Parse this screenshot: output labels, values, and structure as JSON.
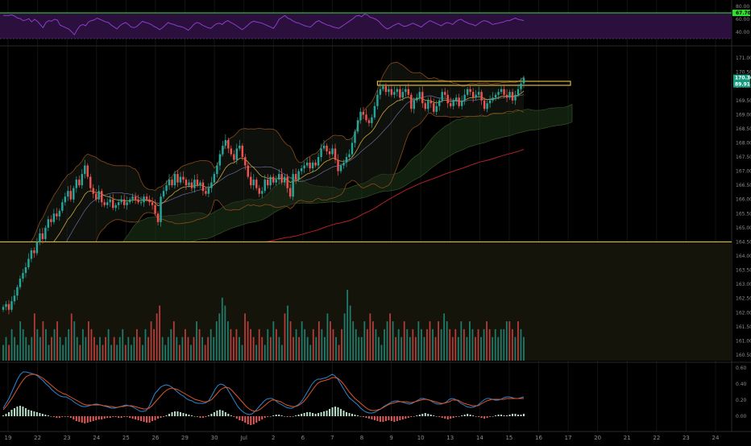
{
  "chart_data": [
    {
      "type": "line",
      "panel": "rsi",
      "yticks": [
        "80.00",
        "60.00",
        "40.00"
      ],
      "guide_levels": [
        70,
        30
      ],
      "ylim": [
        20,
        85
      ],
      "last_value_label": "67.70",
      "colors": {
        "line": "#8a3fc8",
        "band": "#2b0f3d",
        "upper": "#2fe02f",
        "lower": "#2fe02f"
      },
      "series": [
        {
          "values": [
            66,
            66,
            66,
            67,
            65,
            62,
            61,
            58,
            59,
            61,
            56,
            60,
            57,
            52,
            47,
            55,
            58,
            57,
            60,
            59,
            51,
            49,
            47,
            45,
            41,
            36,
            44,
            50,
            52,
            50,
            56,
            58,
            59,
            62,
            60,
            58,
            56,
            55,
            51,
            48,
            45,
            50,
            53,
            55,
            52,
            48,
            47,
            49,
            53,
            57,
            55,
            54,
            52,
            49,
            47,
            44,
            47,
            51,
            55,
            53,
            52,
            50,
            49,
            48,
            46,
            43,
            47,
            52,
            55,
            54,
            51,
            49,
            47,
            46,
            50,
            53,
            54,
            52,
            56,
            58,
            55,
            53,
            50,
            47,
            44,
            47,
            51,
            55,
            57,
            56,
            55,
            54,
            52,
            50,
            48,
            46,
            52,
            60,
            63,
            66,
            62,
            60,
            57,
            55,
            54,
            52,
            50,
            49,
            48,
            52,
            56,
            58,
            55,
            53,
            51,
            50,
            48,
            47,
            46,
            49,
            52,
            55,
            58,
            61,
            65,
            66,
            64,
            68,
            67,
            63,
            62,
            60,
            57,
            52,
            48,
            45,
            47,
            50,
            52,
            54,
            51,
            49,
            50,
            52,
            54,
            52,
            50,
            48,
            52,
            55,
            58,
            56,
            54,
            52,
            50,
            53,
            55,
            54,
            52,
            56,
            59,
            60,
            57,
            55,
            53,
            52,
            50,
            53,
            56,
            58,
            57,
            55,
            52,
            53,
            54,
            55,
            56,
            58,
            58,
            60,
            62,
            60,
            59,
            58
          ]
        }
      ]
    },
    {
      "type": "candlestick",
      "panel": "price",
      "yticks": [
        "171.00",
        "170.50",
        "170.00",
        "169.50",
        "169.00",
        "168.50",
        "168.00",
        "167.50",
        "167.00",
        "166.50",
        "166.00",
        "165.50",
        "165.00",
        "164.50",
        "164.00",
        "163.50",
        "163.00",
        "162.50",
        "162.00",
        "161.50",
        "161.00",
        "160.50"
      ],
      "ylim": [
        160.3,
        171.4
      ],
      "levels": [
        {
          "price": 164.5,
          "color": "#d9b83a"
        }
      ],
      "resistance_box": {
        "price_low": 169.98,
        "price_high": 170.12,
        "color": "#d9b83a"
      },
      "price_labels": [
        {
          "text": "170.30",
          "color": "#1a9e83"
        },
        {
          "text": "89.91",
          "color": "#1a9e83"
        }
      ],
      "colors": {
        "up": "#26a69a",
        "down": "#ef5350",
        "ma_long": "#b0202a",
        "bb": "#8a4a1a",
        "ma_short": "#c9a03a"
      },
      "closes": [
        162.2,
        162.3,
        162.1,
        162.4,
        162.6,
        162.9,
        163.2,
        163.4,
        163.6,
        163.9,
        164.2,
        164.1,
        164.5,
        164.8,
        164.6,
        165.0,
        165.3,
        165.2,
        165.5,
        165.4,
        165.6,
        165.9,
        166.1,
        166.3,
        166.0,
        166.4,
        166.7,
        166.5,
        166.9,
        167.2,
        166.8,
        166.4,
        166.2,
        166.0,
        166.3,
        165.9,
        165.8,
        165.9,
        166.0,
        165.7,
        165.8,
        165.9,
        166.0,
        165.8,
        165.9,
        166.0,
        166.1,
        166.0,
        165.9,
        165.9,
        166.1,
        166.0,
        165.9,
        165.8,
        165.5,
        165.2,
        166.1,
        166.3,
        166.5,
        166.7,
        166.5,
        166.9,
        166.6,
        166.8,
        166.7,
        166.5,
        166.6,
        166.4,
        166.7,
        166.5,
        166.6,
        166.3,
        166.2,
        166.4,
        166.6,
        166.9,
        167.2,
        167.6,
        167.9,
        168.1,
        167.8,
        167.6,
        167.4,
        167.8,
        167.9,
        167.5,
        167.2,
        166.8,
        166.5,
        166.7,
        166.4,
        166.2,
        166.3,
        166.7,
        166.5,
        166.8,
        166.6,
        166.7,
        166.9,
        166.6,
        166.8,
        166.4,
        166.1,
        166.9,
        166.7,
        167.0,
        167.1,
        167.2,
        167.3,
        167.1,
        167.3,
        167.2,
        167.5,
        167.8,
        167.9,
        167.7,
        167.6,
        167.8,
        167.4,
        167.0,
        167.2,
        167.3,
        167.5,
        167.6,
        168.0,
        168.4,
        168.8,
        169.1,
        169.0,
        168.8,
        168.7,
        168.9,
        169.3,
        169.7,
        169.9,
        170.0,
        169.8,
        169.9,
        169.7,
        169.8,
        169.9,
        169.6,
        169.8,
        169.9,
        169.7,
        169.2,
        169.5,
        169.6,
        169.8,
        169.4,
        169.2,
        169.5,
        169.4,
        169.1,
        169.3,
        169.5,
        169.8,
        169.7,
        169.4,
        169.3,
        169.5,
        169.6,
        169.3,
        169.5,
        169.7,
        169.9,
        169.8,
        169.6,
        169.7,
        169.8,
        169.5,
        169.2,
        169.4,
        169.5,
        169.6,
        169.7,
        169.8,
        169.9,
        169.7,
        169.6,
        169.8,
        169.5,
        169.7,
        169.9,
        170.1,
        170.3
      ]
    },
    {
      "type": "bar",
      "panel": "volume",
      "colors": {
        "up": "#1f7a6b",
        "down": "#b33c3a"
      },
      "values": [
        2,
        3,
        2,
        4,
        3,
        2,
        5,
        4,
        3,
        2,
        3,
        6,
        4,
        3,
        5,
        4,
        2,
        3,
        4,
        5,
        3,
        2,
        3,
        4,
        6,
        5,
        3,
        2,
        4,
        3,
        5,
        4,
        3,
        2,
        3,
        2,
        3,
        4,
        2,
        3,
        2,
        3,
        4,
        2,
        3,
        2,
        3,
        4,
        3,
        2,
        4,
        3,
        5,
        4,
        6,
        7,
        3,
        2,
        3,
        4,
        5,
        3,
        2,
        3,
        4,
        3,
        2,
        3,
        5,
        4,
        3,
        2,
        3,
        4,
        3,
        5,
        6,
        8,
        7,
        5,
        4,
        3,
        4,
        3,
        2,
        6,
        5,
        4,
        3,
        2,
        4,
        3,
        2,
        4,
        3,
        5,
        4,
        3,
        2,
        6,
        7,
        5,
        3,
        4,
        3,
        5,
        4,
        3,
        2,
        4,
        3,
        5,
        4,
        3,
        6,
        5,
        4,
        3,
        2,
        4,
        6,
        9,
        7,
        5,
        4,
        3,
        3,
        5,
        4,
        6,
        5,
        4,
        3,
        2,
        4,
        5,
        6,
        5,
        3,
        4,
        3,
        5,
        4,
        3,
        4,
        3,
        5,
        4,
        3,
        4,
        5,
        4,
        3,
        5,
        4,
        6,
        5,
        4,
        3,
        4,
        3,
        5,
        4,
        3,
        5,
        4,
        3,
        4,
        3,
        4,
        5,
        4,
        3,
        4,
        3,
        4,
        4,
        5,
        5,
        4,
        3,
        5,
        4,
        3
      ]
    },
    {
      "type": "bar",
      "panel": "macd",
      "yticks": [
        "0.60",
        "0.40",
        "0.20",
        "0.00"
      ],
      "ylim": [
        -0.15,
        0.65
      ],
      "colors": {
        "pos": "#b9e0c8",
        "neg": "#e35b5b",
        "macd": "#2f86d0",
        "signal": "#e0562a"
      },
      "histogram": [
        0.01,
        0.03,
        0.05,
        0.08,
        0.1,
        0.12,
        0.13,
        0.12,
        0.1,
        0.08,
        0.07,
        0.06,
        0.05,
        0.04,
        0.03,
        0.02,
        0.01,
        0.0,
        -0.01,
        -0.02,
        -0.02,
        -0.01,
        0.0,
        -0.01,
        -0.02,
        -0.04,
        -0.06,
        -0.07,
        -0.08,
        -0.09,
        -0.08,
        -0.07,
        -0.06,
        -0.05,
        -0.04,
        -0.04,
        -0.03,
        -0.02,
        -0.02,
        -0.01,
        -0.01,
        -0.02,
        -0.02,
        -0.01,
        -0.01,
        -0.02,
        -0.03,
        -0.04,
        -0.05,
        -0.06,
        -0.07,
        -0.08,
        -0.08,
        -0.06,
        -0.05,
        -0.03,
        -0.02,
        -0.01,
        0.01,
        0.03,
        0.05,
        0.06,
        0.06,
        0.05,
        0.04,
        0.03,
        0.02,
        0.01,
        0.0,
        -0.01,
        -0.02,
        -0.02,
        -0.01,
        0.01,
        0.03,
        0.05,
        0.07,
        0.08,
        0.07,
        0.05,
        0.03,
        0.01,
        -0.01,
        -0.03,
        -0.05,
        -0.06,
        -0.08,
        -0.1,
        -0.11,
        -0.1,
        -0.08,
        -0.06,
        -0.04,
        -0.02,
        -0.01,
        0.0,
        0.01,
        0.02,
        0.02,
        0.01,
        0.0,
        -0.01,
        -0.01,
        0.0,
        0.01,
        0.02,
        0.03,
        0.04,
        0.05,
        0.05,
        0.04,
        0.03,
        0.04,
        0.05,
        0.06,
        0.07,
        0.09,
        0.11,
        0.12,
        0.11,
        0.09,
        0.07,
        0.05,
        0.04,
        0.03,
        0.02,
        0.01,
        0.0,
        -0.01,
        -0.02,
        -0.03,
        -0.04,
        -0.05,
        -0.06,
        -0.07,
        -0.07,
        -0.06,
        -0.05,
        -0.06,
        -0.07,
        -0.06,
        -0.05,
        -0.04,
        -0.03,
        -0.02,
        -0.01,
        0.0,
        0.01,
        0.02,
        0.03,
        0.04,
        0.03,
        0.02,
        0.01,
        0.0,
        -0.01,
        -0.02,
        -0.03,
        -0.04,
        -0.03,
        -0.02,
        -0.01,
        0.0,
        0.01,
        0.02,
        0.03,
        0.02,
        0.01,
        0.0,
        -0.01,
        -0.02,
        -0.03,
        -0.02,
        -0.01,
        0.0,
        0.01,
        0.02,
        0.02,
        0.01,
        0.01,
        0.02,
        0.03,
        0.03,
        0.02,
        0.02,
        0.03
      ],
      "series": [
        {
          "values": [
            0.1,
            0.16,
            0.22,
            0.3,
            0.38,
            0.46,
            0.52,
            0.55,
            0.55,
            0.54,
            0.53,
            0.52,
            0.5,
            0.47,
            0.44,
            0.4,
            0.37,
            0.33,
            0.3,
            0.27,
            0.25,
            0.24,
            0.24,
            0.22,
            0.2,
            0.17,
            0.15,
            0.13,
            0.12,
            0.12,
            0.13,
            0.14,
            0.15,
            0.15,
            0.14,
            0.13,
            0.12,
            0.11,
            0.1,
            0.1,
            0.11,
            0.12,
            0.13,
            0.14,
            0.13,
            0.12,
            0.1,
            0.08,
            0.06,
            0.06,
            0.07,
            0.12,
            0.2,
            0.28,
            0.32,
            0.36,
            0.38,
            0.39,
            0.38,
            0.36,
            0.33,
            0.3,
            0.27,
            0.25,
            0.22,
            0.2,
            0.19,
            0.17,
            0.16,
            0.16,
            0.16,
            0.17,
            0.2,
            0.26,
            0.33,
            0.38,
            0.4,
            0.39,
            0.36,
            0.3,
            0.24,
            0.18,
            0.12,
            0.08,
            0.05,
            0.03,
            0.02,
            0.03,
            0.06,
            0.1,
            0.14,
            0.18,
            0.21,
            0.22,
            0.22,
            0.2,
            0.17,
            0.15,
            0.13,
            0.11,
            0.1,
            0.1,
            0.12,
            0.14,
            0.17,
            0.22,
            0.28,
            0.34,
            0.4,
            0.44,
            0.46,
            0.46,
            0.47,
            0.48,
            0.5,
            0.52,
            0.5,
            0.46,
            0.4,
            0.34,
            0.28,
            0.23,
            0.2,
            0.17,
            0.14,
            0.1,
            0.07,
            0.05,
            0.04,
            0.04,
            0.05,
            0.07,
            0.09,
            0.12,
            0.14,
            0.16,
            0.18,
            0.19,
            0.19,
            0.18,
            0.17,
            0.16,
            0.15,
            0.16,
            0.18,
            0.2,
            0.22,
            0.22,
            0.21,
            0.2,
            0.18,
            0.16,
            0.15,
            0.15,
            0.16,
            0.18,
            0.21,
            0.22,
            0.21,
            0.19,
            0.16,
            0.14,
            0.12,
            0.11,
            0.11,
            0.12,
            0.14,
            0.17,
            0.2,
            0.22,
            0.22,
            0.21,
            0.2,
            0.2,
            0.21,
            0.23,
            0.24,
            0.24,
            0.23,
            0.22,
            0.22,
            0.23,
            0.24
          ]
        },
        {
          "values": [
            0.08,
            0.12,
            0.17,
            0.22,
            0.28,
            0.34,
            0.4,
            0.45,
            0.49,
            0.51,
            0.52,
            0.52,
            0.51,
            0.49,
            0.47,
            0.44,
            0.41,
            0.38,
            0.35,
            0.32,
            0.3,
            0.28,
            0.27,
            0.25,
            0.23,
            0.21,
            0.19,
            0.17,
            0.15,
            0.14,
            0.14,
            0.14,
            0.14,
            0.14,
            0.14,
            0.13,
            0.13,
            0.12,
            0.12,
            0.11,
            0.11,
            0.12,
            0.12,
            0.13,
            0.13,
            0.13,
            0.12,
            0.11,
            0.1,
            0.09,
            0.09,
            0.1,
            0.13,
            0.17,
            0.21,
            0.25,
            0.29,
            0.32,
            0.34,
            0.35,
            0.34,
            0.33,
            0.31,
            0.29,
            0.27,
            0.25,
            0.23,
            0.21,
            0.2,
            0.19,
            0.18,
            0.18,
            0.19,
            0.21,
            0.25,
            0.29,
            0.33,
            0.35,
            0.36,
            0.35,
            0.32,
            0.28,
            0.24,
            0.2,
            0.16,
            0.12,
            0.09,
            0.07,
            0.06,
            0.07,
            0.09,
            0.12,
            0.15,
            0.18,
            0.2,
            0.2,
            0.19,
            0.18,
            0.16,
            0.14,
            0.13,
            0.12,
            0.12,
            0.13,
            0.15,
            0.18,
            0.22,
            0.27,
            0.32,
            0.37,
            0.41,
            0.43,
            0.44,
            0.45,
            0.46,
            0.48,
            0.48,
            0.47,
            0.44,
            0.4,
            0.35,
            0.3,
            0.26,
            0.22,
            0.19,
            0.16,
            0.13,
            0.1,
            0.08,
            0.07,
            0.07,
            0.08,
            0.09,
            0.11,
            0.13,
            0.15,
            0.16,
            0.17,
            0.18,
            0.18,
            0.18,
            0.18,
            0.17,
            0.17,
            0.18,
            0.19,
            0.2,
            0.21,
            0.21,
            0.2,
            0.19,
            0.18,
            0.17,
            0.16,
            0.16,
            0.17,
            0.18,
            0.2,
            0.2,
            0.2,
            0.18,
            0.16,
            0.15,
            0.14,
            0.13,
            0.13,
            0.13,
            0.15,
            0.17,
            0.19,
            0.2,
            0.21,
            0.21,
            0.21,
            0.21,
            0.21,
            0.22,
            0.22,
            0.22,
            0.22,
            0.22,
            0.22,
            0.22
          ]
        }
      ]
    }
  ],
  "time_axis": {
    "labels": [
      "19",
      "22",
      "23",
      "24",
      "25",
      "26",
      "29",
      "30",
      "Jul",
      "2",
      "6",
      "7",
      "8",
      "9",
      "10",
      "13",
      "14",
      "15",
      "16",
      "17",
      "20",
      "21",
      "22",
      "23",
      "24"
    ]
  }
}
